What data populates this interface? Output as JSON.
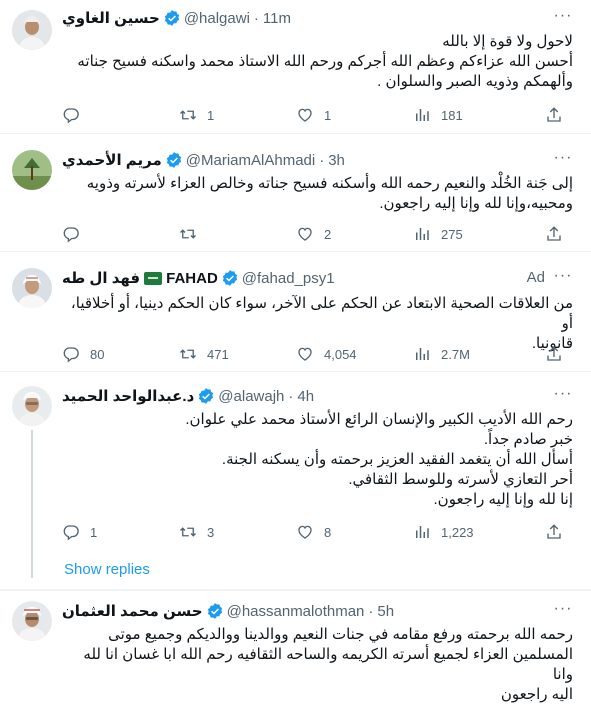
{
  "tweets": [
    {
      "name": "حسين الغاوي",
      "handle": "@halgawi",
      "time": "11m",
      "lines": [
        "لاحول ولا قوة إلا بالله",
        "أحسن الله عزاءكم وعظم الله أجركم ورحم الله الاستاذ محمد واسكنه فسيح جناته",
        "وألهمكم وذويه الصبر والسلوان ."
      ],
      "replies": "",
      "retweets": "1",
      "likes": "1",
      "views": "181"
    },
    {
      "name": "مريم الأحمدي",
      "handle": "@MariamAlAhmadi",
      "time": "3h",
      "lines": [
        "إلى جَنة الخُلْد والنعيم رحمه الله وأسكنه فسيح جناته وخالص العزاء لأسرته وذويه",
        "ومحبيه،وإنا لله وإنا إليه راجعون."
      ],
      "replies": "",
      "retweets": "",
      "likes": "2",
      "views": "275"
    },
    {
      "name": "FAHAD",
      "name_prefix": "فهد ال طه",
      "handle": "@fahad_psy1",
      "ad_label": "Ad",
      "lines": [
        "من العلاقات الصحية الابتعاد عن الحكم على الآخر، سواء كان الحكم دينيا، أو أخلاقيا، أو",
        "قانونيا."
      ],
      "replies": "80",
      "retweets": "471",
      "likes": "4,054",
      "views": "2.7M"
    },
    {
      "name": "د.عبدالواحد الحميد",
      "handle": "@alawajh",
      "time": "4h",
      "lines": [
        "رحم الله الأديب الكبير والإنسان الرائع الأستاذ محمد علي علوان.",
        "خبر صادم جداً.",
        "أسأل الله أن يتغمد الفقيد العزيز برحمته وأن يسكنه الجنة.",
        "أحر التعازي لأسرته وللوسط الثقافي.",
        "إنا لله وإنا إليه راجعون."
      ],
      "replies": "1",
      "retweets": "3",
      "likes": "8",
      "views": "1,223"
    },
    {
      "name": "حسن محمد العثمان",
      "handle": "@hassanmalothman",
      "time": "5h",
      "lines": [
        "رحمه الله برحمته ورفع مقامه في جنات النعيم ووالدينا ووالديكم وجميع موتى",
        "المسلمين العزاء لجميع أسرته الكريمه والساحه الثقافيه رحم الله ابا غسان انا لله وانا",
        "اليه راجعون"
      ]
    }
  ],
  "show_replies": "Show replies",
  "colors": {
    "accent": "#1d9bf0",
    "muted": "#536471",
    "text": "#0f1419",
    "border": "#eff3f4"
  }
}
